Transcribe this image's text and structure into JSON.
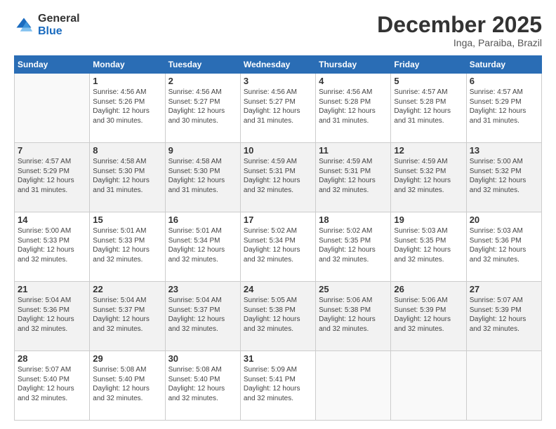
{
  "header": {
    "logo_general": "General",
    "logo_blue": "Blue",
    "month_title": "December 2025",
    "location": "Inga, Paraiba, Brazil"
  },
  "weekdays": [
    "Sunday",
    "Monday",
    "Tuesday",
    "Wednesday",
    "Thursday",
    "Friday",
    "Saturday"
  ],
  "weeks": [
    [
      {
        "day": "",
        "empty": true
      },
      {
        "day": "1",
        "rise": "4:56 AM",
        "set": "5:26 PM",
        "daylight": "12 hours and 30 minutes."
      },
      {
        "day": "2",
        "rise": "4:56 AM",
        "set": "5:27 PM",
        "daylight": "12 hours and 30 minutes."
      },
      {
        "day": "3",
        "rise": "4:56 AM",
        "set": "5:27 PM",
        "daylight": "12 hours and 31 minutes."
      },
      {
        "day": "4",
        "rise": "4:56 AM",
        "set": "5:28 PM",
        "daylight": "12 hours and 31 minutes."
      },
      {
        "day": "5",
        "rise": "4:57 AM",
        "set": "5:28 PM",
        "daylight": "12 hours and 31 minutes."
      },
      {
        "day": "6",
        "rise": "4:57 AM",
        "set": "5:29 PM",
        "daylight": "12 hours and 31 minutes."
      }
    ],
    [
      {
        "day": "7",
        "rise": "4:57 AM",
        "set": "5:29 PM",
        "daylight": "12 hours and 31 minutes."
      },
      {
        "day": "8",
        "rise": "4:58 AM",
        "set": "5:30 PM",
        "daylight": "12 hours and 31 minutes."
      },
      {
        "day": "9",
        "rise": "4:58 AM",
        "set": "5:30 PM",
        "daylight": "12 hours and 31 minutes."
      },
      {
        "day": "10",
        "rise": "4:59 AM",
        "set": "5:31 PM",
        "daylight": "12 hours and 32 minutes."
      },
      {
        "day": "11",
        "rise": "4:59 AM",
        "set": "5:31 PM",
        "daylight": "12 hours and 32 minutes."
      },
      {
        "day": "12",
        "rise": "4:59 AM",
        "set": "5:32 PM",
        "daylight": "12 hours and 32 minutes."
      },
      {
        "day": "13",
        "rise": "5:00 AM",
        "set": "5:32 PM",
        "daylight": "12 hours and 32 minutes."
      }
    ],
    [
      {
        "day": "14",
        "rise": "5:00 AM",
        "set": "5:33 PM",
        "daylight": "12 hours and 32 minutes."
      },
      {
        "day": "15",
        "rise": "5:01 AM",
        "set": "5:33 PM",
        "daylight": "12 hours and 32 minutes."
      },
      {
        "day": "16",
        "rise": "5:01 AM",
        "set": "5:34 PM",
        "daylight": "12 hours and 32 minutes."
      },
      {
        "day": "17",
        "rise": "5:02 AM",
        "set": "5:34 PM",
        "daylight": "12 hours and 32 minutes."
      },
      {
        "day": "18",
        "rise": "5:02 AM",
        "set": "5:35 PM",
        "daylight": "12 hours and 32 minutes."
      },
      {
        "day": "19",
        "rise": "5:03 AM",
        "set": "5:35 PM",
        "daylight": "12 hours and 32 minutes."
      },
      {
        "day": "20",
        "rise": "5:03 AM",
        "set": "5:36 PM",
        "daylight": "12 hours and 32 minutes."
      }
    ],
    [
      {
        "day": "21",
        "rise": "5:04 AM",
        "set": "5:36 PM",
        "daylight": "12 hours and 32 minutes."
      },
      {
        "day": "22",
        "rise": "5:04 AM",
        "set": "5:37 PM",
        "daylight": "12 hours and 32 minutes."
      },
      {
        "day": "23",
        "rise": "5:04 AM",
        "set": "5:37 PM",
        "daylight": "12 hours and 32 minutes."
      },
      {
        "day": "24",
        "rise": "5:05 AM",
        "set": "5:38 PM",
        "daylight": "12 hours and 32 minutes."
      },
      {
        "day": "25",
        "rise": "5:06 AM",
        "set": "5:38 PM",
        "daylight": "12 hours and 32 minutes."
      },
      {
        "day": "26",
        "rise": "5:06 AM",
        "set": "5:39 PM",
        "daylight": "12 hours and 32 minutes."
      },
      {
        "day": "27",
        "rise": "5:07 AM",
        "set": "5:39 PM",
        "daylight": "12 hours and 32 minutes."
      }
    ],
    [
      {
        "day": "28",
        "rise": "5:07 AM",
        "set": "5:40 PM",
        "daylight": "12 hours and 32 minutes."
      },
      {
        "day": "29",
        "rise": "5:08 AM",
        "set": "5:40 PM",
        "daylight": "12 hours and 32 minutes."
      },
      {
        "day": "30",
        "rise": "5:08 AM",
        "set": "5:40 PM",
        "daylight": "12 hours and 32 minutes."
      },
      {
        "day": "31",
        "rise": "5:09 AM",
        "set": "5:41 PM",
        "daylight": "12 hours and 32 minutes."
      },
      {
        "day": "",
        "empty": true
      },
      {
        "day": "",
        "empty": true
      },
      {
        "day": "",
        "empty": true
      }
    ]
  ],
  "labels": {
    "sunrise": "Sunrise:",
    "sunset": "Sunset:",
    "daylight": "Daylight:"
  }
}
